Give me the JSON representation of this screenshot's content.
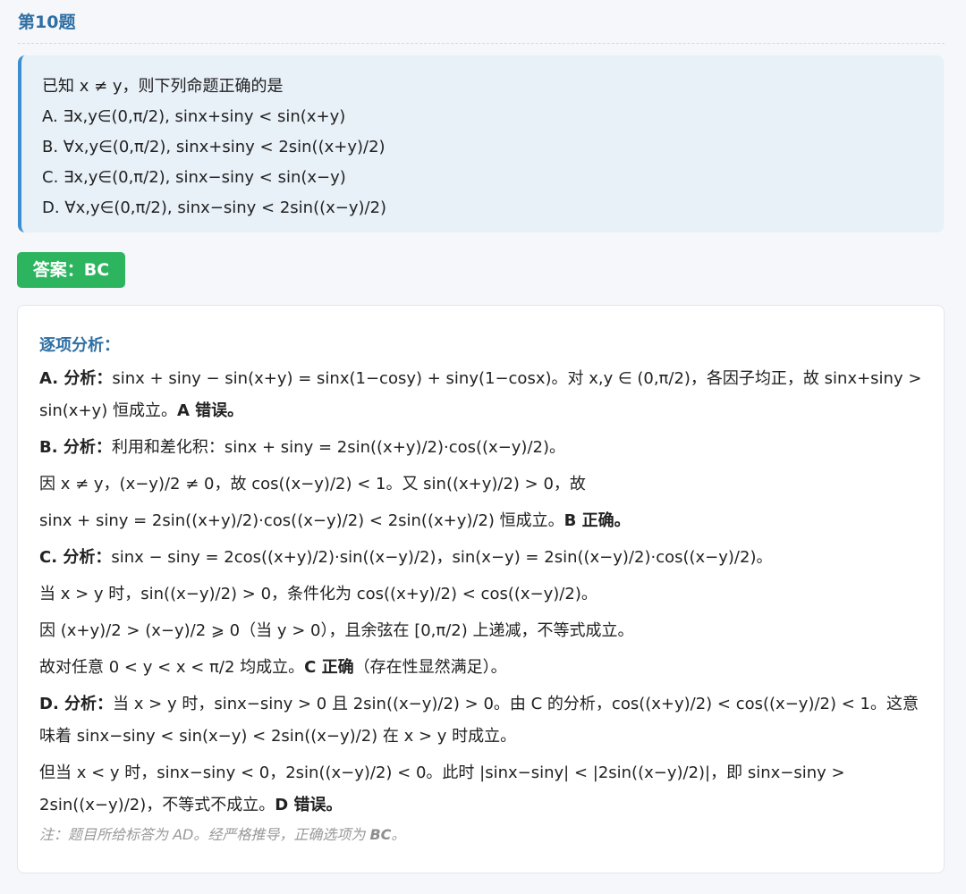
{
  "header": {
    "title": "第10题"
  },
  "question": {
    "stem": "已知 x ≠ y，则下列命题正确的是",
    "options": [
      "A. ∃x,y∈(0,π/2), sinx+siny < sin(x+y)",
      "B. ∀x,y∈(0,π/2), sinx+siny < 2sin((x+y)/2)",
      "C. ∃x,y∈(0,π/2), sinx−siny < sin(x−y)",
      "D. ∀x,y∈(0,π/2), sinx−siny < 2sin((x−y)/2)"
    ]
  },
  "answer": {
    "label": "答案：BC"
  },
  "analysis": {
    "heading": "逐项分析：",
    "a": {
      "label": "A. 分析：",
      "text": "sinx + siny − sin(x+y) = sinx(1−cosy) + siny(1−cosx)。对 x,y ∈ (0,π/2)，各因子均正，故 sinx+siny > sin(x+y) 恒成立。",
      "verdict": "A 错误。"
    },
    "b": {
      "label": "B. 分析：",
      "line1": "利用和差化积：sinx + siny = 2sin((x+y)/2)·cos((x−y)/2)。",
      "line2": "因 x ≠ y，(x−y)/2 ≠ 0，故 cos((x−y)/2) < 1。又 sin((x+y)/2) > 0，故",
      "line3": "sinx + siny = 2sin((x+y)/2)·cos((x−y)/2) < 2sin((x+y)/2) 恒成立。",
      "verdict": "B 正确。"
    },
    "c": {
      "label": "C. 分析：",
      "line1": "sinx − siny = 2cos((x+y)/2)·sin((x−y)/2)，sin(x−y) = 2sin((x−y)/2)·cos((x−y)/2)。",
      "line2": "当 x > y 时，sin((x−y)/2) > 0，条件化为 cos((x+y)/2) < cos((x−y)/2)。",
      "line3": "因 (x+y)/2 > (x−y)/2 ⩾ 0（当 y > 0），且余弦在 [0,π/2) 上递减，不等式成立。",
      "line4_prefix": "故对任意 0 < y < x < π/2 均成立。",
      "verdict": "C 正确",
      "line4_suffix": "（存在性显然满足）。"
    },
    "d": {
      "label": "D. 分析：",
      "line1": "当 x > y 时，sinx−siny > 0 且 2sin((x−y)/2) > 0。由 C 的分析，cos((x+y)/2) < cos((x−y)/2) < 1。这意味着 sinx−siny < sin(x−y) < 2sin((x−y)/2) 在 x > y 时成立。",
      "line2": "但当 x < y 时，sinx−siny < 0，2sin((x−y)/2) < 0。此时 |sinx−siny| < |2sin((x−y)/2)|，即 sinx−siny > 2sin((x−y)/2)，不等式不成立。",
      "verdict": "D 错误。"
    },
    "note": {
      "prefix": "注：题目所给标答为 AD。经严格推导，正确选项为 ",
      "emphasis": "BC",
      "suffix": "。"
    }
  }
}
